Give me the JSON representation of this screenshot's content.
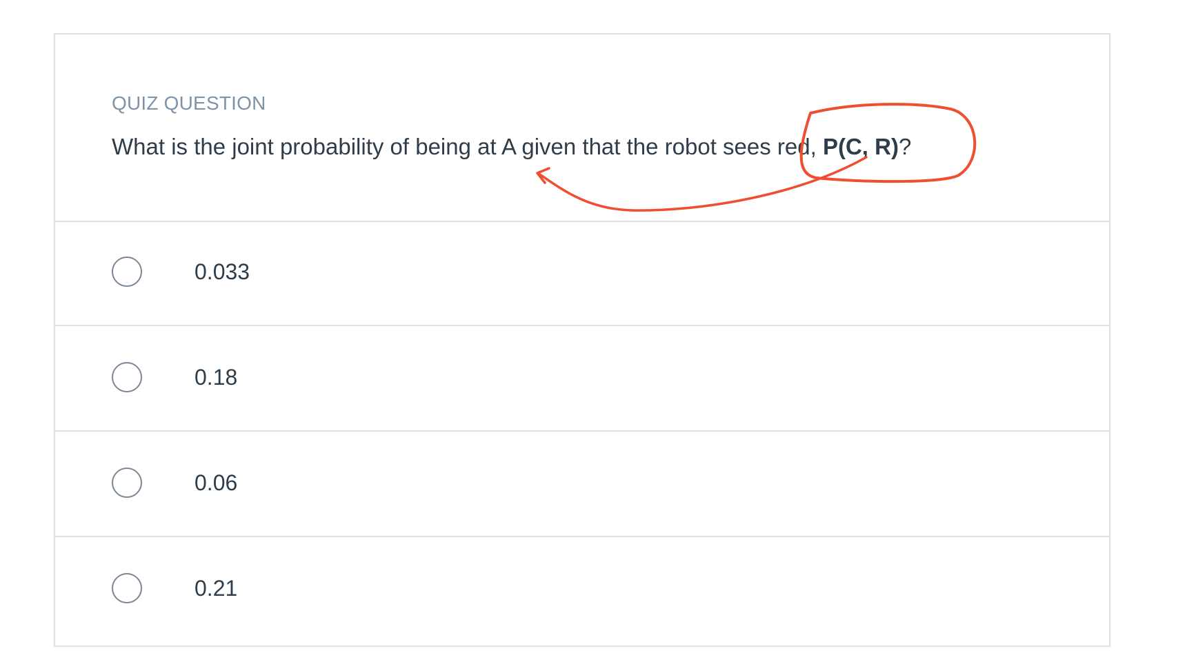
{
  "quiz": {
    "label": "QUIZ QUESTION",
    "question_prefix": "What is the joint probability of being at A given that the robot sees red, ",
    "question_emphasis": "P(C, R)",
    "question_suffix": "?",
    "options": [
      {
        "label": "0.033"
      },
      {
        "label": "0.18"
      },
      {
        "label": "0.06"
      },
      {
        "label": "0.21"
      }
    ]
  },
  "colors": {
    "annotation": "#f04e30",
    "text": "#2e3d49",
    "muted": "#7f93a8",
    "border": "#dbe2e8"
  }
}
